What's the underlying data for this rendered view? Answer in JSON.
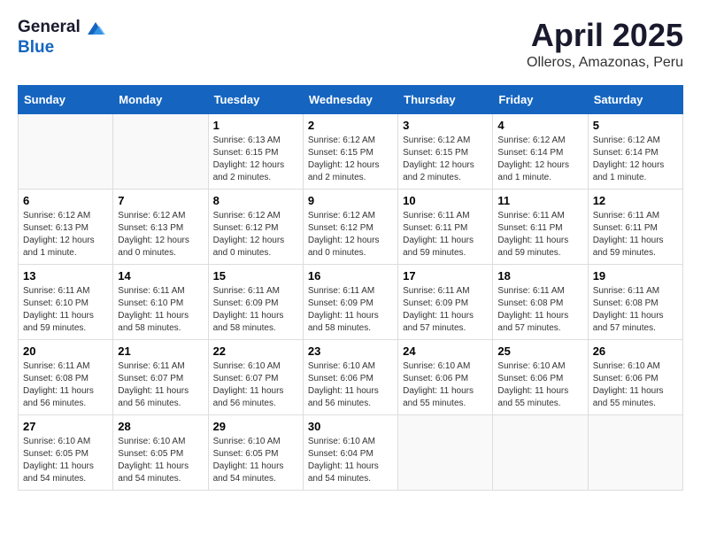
{
  "header": {
    "logo_general": "General",
    "logo_blue": "Blue",
    "month_title": "April 2025",
    "location": "Olleros, Amazonas, Peru"
  },
  "calendar": {
    "days_of_week": [
      "Sunday",
      "Monday",
      "Tuesday",
      "Wednesday",
      "Thursday",
      "Friday",
      "Saturday"
    ],
    "weeks": [
      [
        {
          "day": "",
          "info": ""
        },
        {
          "day": "",
          "info": ""
        },
        {
          "day": "1",
          "info": "Sunrise: 6:13 AM\nSunset: 6:15 PM\nDaylight: 12 hours and 2 minutes."
        },
        {
          "day": "2",
          "info": "Sunrise: 6:12 AM\nSunset: 6:15 PM\nDaylight: 12 hours and 2 minutes."
        },
        {
          "day": "3",
          "info": "Sunrise: 6:12 AM\nSunset: 6:15 PM\nDaylight: 12 hours and 2 minutes."
        },
        {
          "day": "4",
          "info": "Sunrise: 6:12 AM\nSunset: 6:14 PM\nDaylight: 12 hours and 1 minute."
        },
        {
          "day": "5",
          "info": "Sunrise: 6:12 AM\nSunset: 6:14 PM\nDaylight: 12 hours and 1 minute."
        }
      ],
      [
        {
          "day": "6",
          "info": "Sunrise: 6:12 AM\nSunset: 6:13 PM\nDaylight: 12 hours and 1 minute."
        },
        {
          "day": "7",
          "info": "Sunrise: 6:12 AM\nSunset: 6:13 PM\nDaylight: 12 hours and 0 minutes."
        },
        {
          "day": "8",
          "info": "Sunrise: 6:12 AM\nSunset: 6:12 PM\nDaylight: 12 hours and 0 minutes."
        },
        {
          "day": "9",
          "info": "Sunrise: 6:12 AM\nSunset: 6:12 PM\nDaylight: 12 hours and 0 minutes."
        },
        {
          "day": "10",
          "info": "Sunrise: 6:11 AM\nSunset: 6:11 PM\nDaylight: 11 hours and 59 minutes."
        },
        {
          "day": "11",
          "info": "Sunrise: 6:11 AM\nSunset: 6:11 PM\nDaylight: 11 hours and 59 minutes."
        },
        {
          "day": "12",
          "info": "Sunrise: 6:11 AM\nSunset: 6:11 PM\nDaylight: 11 hours and 59 minutes."
        }
      ],
      [
        {
          "day": "13",
          "info": "Sunrise: 6:11 AM\nSunset: 6:10 PM\nDaylight: 11 hours and 59 minutes."
        },
        {
          "day": "14",
          "info": "Sunrise: 6:11 AM\nSunset: 6:10 PM\nDaylight: 11 hours and 58 minutes."
        },
        {
          "day": "15",
          "info": "Sunrise: 6:11 AM\nSunset: 6:09 PM\nDaylight: 11 hours and 58 minutes."
        },
        {
          "day": "16",
          "info": "Sunrise: 6:11 AM\nSunset: 6:09 PM\nDaylight: 11 hours and 58 minutes."
        },
        {
          "day": "17",
          "info": "Sunrise: 6:11 AM\nSunset: 6:09 PM\nDaylight: 11 hours and 57 minutes."
        },
        {
          "day": "18",
          "info": "Sunrise: 6:11 AM\nSunset: 6:08 PM\nDaylight: 11 hours and 57 minutes."
        },
        {
          "day": "19",
          "info": "Sunrise: 6:11 AM\nSunset: 6:08 PM\nDaylight: 11 hours and 57 minutes."
        }
      ],
      [
        {
          "day": "20",
          "info": "Sunrise: 6:11 AM\nSunset: 6:08 PM\nDaylight: 11 hours and 56 minutes."
        },
        {
          "day": "21",
          "info": "Sunrise: 6:11 AM\nSunset: 6:07 PM\nDaylight: 11 hours and 56 minutes."
        },
        {
          "day": "22",
          "info": "Sunrise: 6:10 AM\nSunset: 6:07 PM\nDaylight: 11 hours and 56 minutes."
        },
        {
          "day": "23",
          "info": "Sunrise: 6:10 AM\nSunset: 6:06 PM\nDaylight: 11 hours and 56 minutes."
        },
        {
          "day": "24",
          "info": "Sunrise: 6:10 AM\nSunset: 6:06 PM\nDaylight: 11 hours and 55 minutes."
        },
        {
          "day": "25",
          "info": "Sunrise: 6:10 AM\nSunset: 6:06 PM\nDaylight: 11 hours and 55 minutes."
        },
        {
          "day": "26",
          "info": "Sunrise: 6:10 AM\nSunset: 6:06 PM\nDaylight: 11 hours and 55 minutes."
        }
      ],
      [
        {
          "day": "27",
          "info": "Sunrise: 6:10 AM\nSunset: 6:05 PM\nDaylight: 11 hours and 54 minutes."
        },
        {
          "day": "28",
          "info": "Sunrise: 6:10 AM\nSunset: 6:05 PM\nDaylight: 11 hours and 54 minutes."
        },
        {
          "day": "29",
          "info": "Sunrise: 6:10 AM\nSunset: 6:05 PM\nDaylight: 11 hours and 54 minutes."
        },
        {
          "day": "30",
          "info": "Sunrise: 6:10 AM\nSunset: 6:04 PM\nDaylight: 11 hours and 54 minutes."
        },
        {
          "day": "",
          "info": ""
        },
        {
          "day": "",
          "info": ""
        },
        {
          "day": "",
          "info": ""
        }
      ]
    ]
  }
}
